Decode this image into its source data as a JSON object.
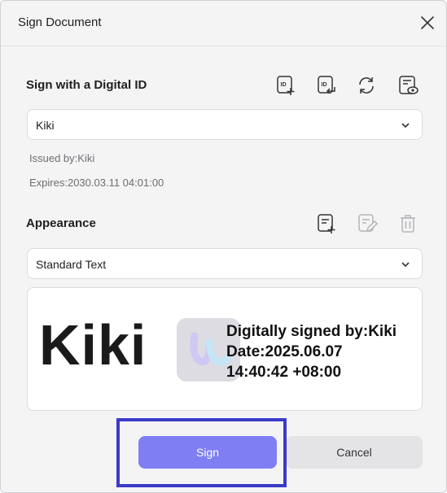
{
  "dialog": {
    "title": "Sign Document"
  },
  "digital_id": {
    "section_title": "Sign with a Digital ID",
    "icons": [
      "id-add-icon",
      "id-import-icon",
      "refresh-icon",
      "id-preview-icon"
    ],
    "selected": "Kiki",
    "issued_by": "Issued by:Kiki",
    "expires": "Expires:2030.03.11 04:01:00"
  },
  "appearance": {
    "section_title": "Appearance",
    "icons": [
      "appearance-add-icon",
      "appearance-edit-icon",
      "appearance-delete-icon"
    ],
    "selected": "Standard Text"
  },
  "preview": {
    "name": "Kiki",
    "line1": "Digitally signed by:Kiki",
    "line2": "Date:2025.06.07",
    "line3": "14:40:42 +08:00"
  },
  "buttons": {
    "sign": "Sign",
    "cancel": "Cancel"
  },
  "colors": {
    "accent": "#7f7ff3",
    "highlight": "#3b3bc9",
    "dialog_bg": "#f4f4f5"
  }
}
